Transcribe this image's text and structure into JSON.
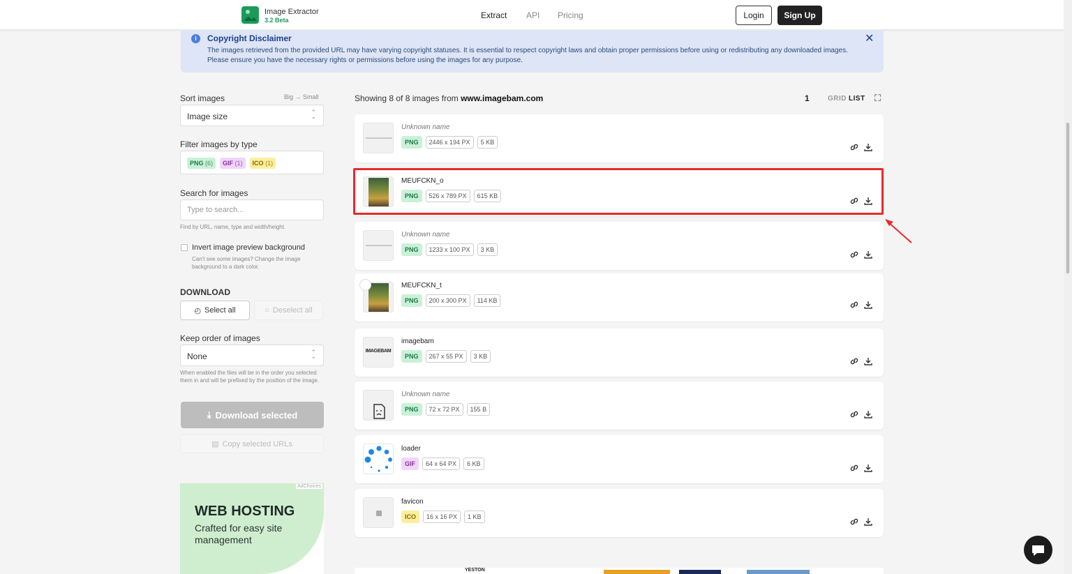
{
  "header": {
    "brand_name": "Image Extractor",
    "brand_version": "3.2 Beta",
    "nav": [
      "Extract",
      "API",
      "Pricing"
    ],
    "login": "Login",
    "signup": "Sign Up"
  },
  "notice": {
    "title": "Copyright Disclaimer",
    "text": "The images retrieved from the provided URL may have varying copyright statuses. It is essential to respect copyright laws and obtain proper permissions before using or redistributing any downloaded images. Please ensure you have the necessary rights or permissions before using the images for any purpose.",
    "close_icon": "close-icon"
  },
  "sidebar": {
    "sort_label": "Sort images",
    "sort_from": "Big",
    "sort_to": "Small",
    "sort_value": "Image size",
    "filter_label": "Filter images by type",
    "filters": [
      {
        "type": "PNG",
        "count": "(6)"
      },
      {
        "type": "GIF",
        "count": "(1)"
      },
      {
        "type": "ICO",
        "count": "(1)"
      }
    ],
    "search_label": "Search for images",
    "search_placeholder": "Type to search...",
    "search_hint": "Find by URL, name, type and width/height.",
    "invert_label": "Invert image preview background",
    "invert_hint": "Can't see some images? Change the image background to a dark color.",
    "download_heading": "DOWNLOAD",
    "select_all": "Select all",
    "deselect_all": "Deselect all",
    "order_label": "Keep order of images",
    "order_value": "None",
    "order_hint": "When enabled the files will be in the order you selected them in and will be prefixed by the position of the image.",
    "download_selected": "Download selected",
    "copy_urls": "Copy selected URLs"
  },
  "ad": {
    "adchoices": "AdChoices",
    "headline": "WEB HOSTING",
    "sub": "Crafted for easy site management"
  },
  "results": {
    "showing_prefix": "Showing 8 of 8 images from",
    "domain": "www.imagebam.com",
    "page": "1",
    "view_grid": "GRID",
    "view_list": "LIST"
  },
  "images": [
    {
      "name": "Unknown name",
      "unknown": true,
      "type": "PNG",
      "dims": "2446 x 194 PX",
      "size": "5 KB"
    },
    {
      "name": "MEUFCKN_o",
      "unknown": false,
      "type": "PNG",
      "dims": "526 x 789 PX",
      "size": "615 KB"
    },
    {
      "name": "Unknown name",
      "unknown": true,
      "type": "PNG",
      "dims": "1233 x 100 PX",
      "size": "3 KB"
    },
    {
      "name": "MEUFCKN_t",
      "unknown": false,
      "type": "PNG",
      "dims": "200 x 300 PX",
      "size": "114 KB"
    },
    {
      "name": "imagebam",
      "unknown": false,
      "type": "PNG",
      "dims": "267 x 55 PX",
      "size": "3 KB"
    },
    {
      "name": "Unknown name",
      "unknown": true,
      "type": "PNG",
      "dims": "72 x 72 PX",
      "size": "155 B"
    },
    {
      "name": "loader",
      "unknown": false,
      "type": "GIF",
      "dims": "64 x 64 PX",
      "size": "6 KB"
    },
    {
      "name": "favicon",
      "unknown": false,
      "type": "ICO",
      "dims": "16 x 16 PX",
      "size": "1 KB"
    }
  ],
  "thumb_logo_text": "IMAGEBAM",
  "bottom_ad_text": "YESTON",
  "colors": {
    "highlight": "#e82a2a",
    "png": "#c9f1d8",
    "gif": "#f0d6f7",
    "ico": "#fcef9c",
    "notice_bg": "#dde5f6"
  }
}
